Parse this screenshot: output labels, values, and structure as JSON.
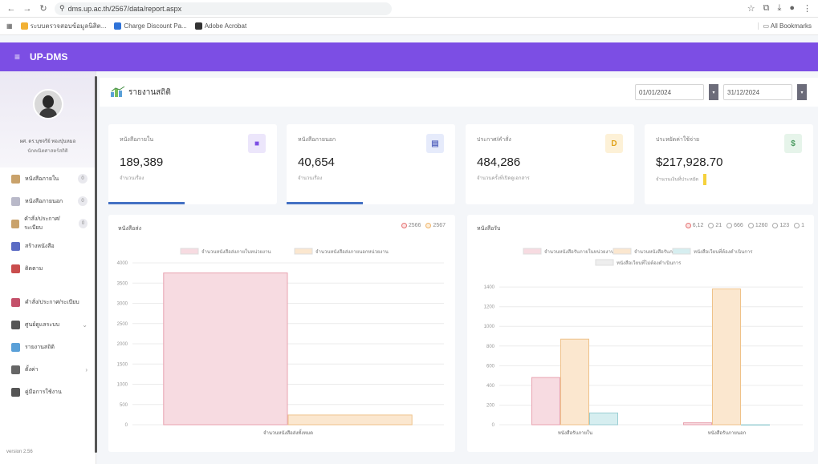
{
  "browser": {
    "url": "dms.up.ac.th/2567/data/report.aspx",
    "bookmarks": [
      "ระบบตรวจสอบข้อมูลนิสิต...",
      "Charge Discount Pa...",
      "Adobe Acrobat"
    ],
    "all_bookmarks": "All Bookmarks"
  },
  "app": {
    "title": "UP-DMS",
    "accent": "#7c4ee4"
  },
  "sidebar": {
    "profile_name": "ผศ. ดร.นุชจรีย์ ทองปุ่นหมอ",
    "profile_dept": "นักคณิตศาสตร์สถิติ",
    "items": [
      {
        "label": "หนังสือภายใน",
        "badge": "0",
        "icon": "inbox-doc-icon"
      },
      {
        "label": "หนังสือภายนอก",
        "badge": "0",
        "icon": "outbox-doc-icon"
      },
      {
        "label": "คำสั่ง/ประกาศ/ระเบียบ",
        "badge": "0",
        "icon": "order-doc-icon"
      },
      {
        "label": "สร้างหนังสือ",
        "badge": "",
        "icon": "create-doc-icon"
      },
      {
        "label": "ติดตาม",
        "badge": "",
        "icon": "follow-icon"
      },
      {
        "label": "คำสั่ง/ประกาศ/ระเบียบ",
        "badge": "",
        "icon": "order-list-icon"
      },
      {
        "label": "ศูนย์ดูแลระบบ",
        "badge": "",
        "icon": "admin-icon",
        "chevron": "⌄"
      },
      {
        "label": "รายงานสถิติ",
        "badge": "",
        "icon": "report-icon"
      },
      {
        "label": "ตั้งค่า",
        "badge": "",
        "icon": "settings-icon",
        "chevron": "›"
      },
      {
        "label": "คู่มือการใช้งาน",
        "badge": "",
        "icon": "manual-icon"
      }
    ],
    "footer": "version 2.56"
  },
  "page": {
    "title": "รายงานสถิติ",
    "date_from": "01/01/2024",
    "date_to": "31/12/2024"
  },
  "stats": [
    {
      "label": "หนังสือภายใน",
      "value": "189,389",
      "sub": "จำนวนเรื่อง",
      "icon_char": "■",
      "icon_bg": "#ece6fb",
      "icon_color": "#7c4ee4",
      "progress": 0.45
    },
    {
      "label": "หนังสือภายนอก",
      "value": "40,654",
      "sub": "จำนวนเรื่อง",
      "icon_char": "▤",
      "icon_bg": "#e6ebfb",
      "icon_color": "#6270c4",
      "progress": 0.45
    },
    {
      "label": "ประกาศ/คำสั่ง",
      "value": "484,286",
      "sub": "จำนวนครั้งที่เปิดดูเอกสาร",
      "icon_char": "D",
      "icon_bg": "#fdf1d7",
      "icon_color": "#e0a31c",
      "progress": 0
    },
    {
      "label": "ประหยัดค่าใช้จ่าย",
      "value": "$217,928.70",
      "sub": "จำนวนเงินที่ประหยัด",
      "icon_char": "$",
      "icon_bg": "#e6f4ea",
      "icon_color": "#4a9a60",
      "progress": 0
    }
  ],
  "chart_left": {
    "title": "หนังสือส่ง",
    "filters": [
      "2566",
      "2567"
    ],
    "legend": [
      "จำนวนหนังสือส่งภายในหน่วยงาน",
      "จำนวนหนังสือส่งภายนอกหน่วยงาน"
    ]
  },
  "chart_right": {
    "title": "หนังสือรับ",
    "filters": [
      "6,12",
      "21",
      "666",
      "1260",
      "123",
      "1"
    ],
    "legend": [
      "จำนวนหนังสือรับภายในหน่วยงาน",
      "จำนวนหนังสือรับภายนอก",
      "หนังสือเวียนที่ต้องดำเนินการ",
      "หนังสือเวียนที่ไม่ต้องดำเนินการ"
    ]
  },
  "chart_data": [
    {
      "type": "bar",
      "categories": [
        "จำนวนหนังสือส่งทั้งหมด"
      ],
      "series": [
        {
          "name": "จำนวนหนังสือส่งภายในหน่วยงาน",
          "values": [
            3750
          ],
          "color": "#f7dbe1"
        },
        {
          "name": "จำนวนหนังสือส่งภายนอกหน่วยงาน",
          "values": [
            240
          ],
          "color": "#fbe7cf"
        }
      ],
      "yticks": [
        "0",
        "500",
        "1000",
        "1500",
        "2000",
        "2500",
        "3000",
        "3500",
        "4000"
      ],
      "ylim": [
        0,
        4000
      ]
    },
    {
      "type": "bar",
      "categories": [
        "หนังสือรับภายใน",
        "หนังสือรับภายนอก"
      ],
      "series": [
        {
          "name": "จำนวนหนังสือรับภายในหน่วยงาน",
          "values": [
            480,
            20
          ],
          "color": "#f7dbe1"
        },
        {
          "name": "จำนวนหนังสือรับภายนอก",
          "values": [
            870,
            1380
          ],
          "color": "#fbe7cf"
        },
        {
          "name": "หนังสือเวียนที่ต้องดำเนินการ",
          "values": [
            120,
            0
          ],
          "color": "#d6eef0"
        }
      ],
      "yticks": [
        "0",
        "200",
        "400",
        "600",
        "800",
        "1000",
        "1200",
        "1400"
      ],
      "ylim": [
        0,
        1450
      ]
    }
  ]
}
